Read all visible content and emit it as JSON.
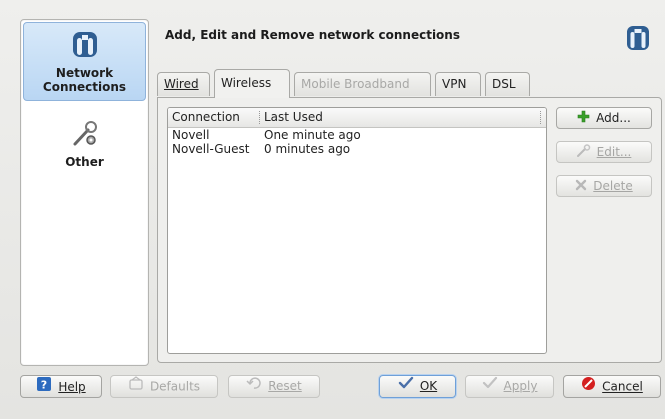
{
  "sidebar": {
    "items": [
      {
        "label_line1": "Network",
        "label_line2": "Connections",
        "icon": "network-connections-icon",
        "selected": true
      },
      {
        "label_line1": "Other",
        "label_line2": "",
        "icon": "wrench-gear-icon",
        "selected": false
      }
    ]
  },
  "header": {
    "title": "Add, Edit and Remove network connections",
    "icon": "network-connections-icon"
  },
  "tabs": [
    {
      "label": "Wired",
      "state": "normal"
    },
    {
      "label": "Wireless",
      "state": "active"
    },
    {
      "label": "Mobile Broadband",
      "state": "disabled"
    },
    {
      "label": "VPN",
      "state": "normal"
    },
    {
      "label": "DSL",
      "state": "normal"
    }
  ],
  "connections_table": {
    "columns": [
      "Connection",
      "Last Used"
    ],
    "rows": [
      {
        "connection": "Novell",
        "last_used": "One minute ago"
      },
      {
        "connection": "Novell-Guest",
        "last_used": "0 minutes ago"
      }
    ]
  },
  "side_buttons": {
    "add": "Add...",
    "edit": "Edit...",
    "delete": "Delete"
  },
  "footer": {
    "help": "Help",
    "defaults": "Defaults",
    "reset": "Reset",
    "ok": "OK",
    "apply": "Apply",
    "cancel": "Cancel"
  },
  "colors": {
    "selection_bg": "#b9d6f3",
    "add_green": "#3aa02a",
    "cancel_red": "#d42020",
    "brand_blue": "#2f5e92"
  }
}
